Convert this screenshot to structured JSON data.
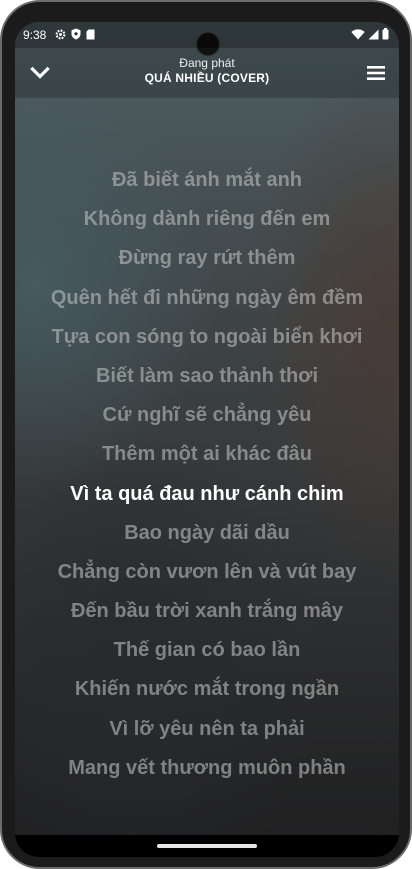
{
  "status_bar": {
    "time": "9:38",
    "left_icons": [
      "gear-icon",
      "shield-icon",
      "sd-card-icon"
    ],
    "right_icons": [
      "wifi-icon",
      "signal-icon",
      "battery-icon"
    ]
  },
  "header": {
    "subtitle": "Đang phát",
    "title": "QUÁ NHIỀU (COVER)",
    "collapse_icon": "chevron-down-icon",
    "menu_icon": "menu-icon"
  },
  "lyrics": {
    "active_index": 8,
    "lines": [
      "Đã biết ánh mắt anh",
      "Không dành riêng đến em",
      "Đừng ray rứt thêm",
      "Quên hết đi những ngày êm đềm",
      "Tựa con sóng to ngoài biển khơi",
      "Biết làm sao thảnh thơi",
      "Cứ nghĩ sẽ chẳng yêu",
      "Thêm một ai khác đâu",
      "Vì ta quá đau như cánh chim",
      "Bao ngày dãi dầu",
      "Chẳng còn vươn lên và vút bay",
      "Đến bầu trời xanh trắng mây",
      "Thế gian có bao lần",
      "Khiến nước mắt trong ngần",
      "Vì lỡ yêu nên ta phải",
      "Mang vết thương muôn phần"
    ]
  },
  "colors": {
    "active_lyric": "#ffffff",
    "inactive_lyric": "#bebebe",
    "nav_bar": "#000000"
  }
}
